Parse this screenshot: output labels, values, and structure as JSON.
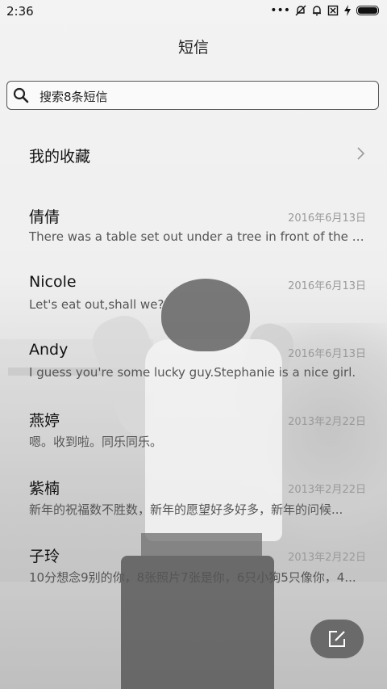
{
  "status_bar": {
    "time": "2:36",
    "icons": [
      "more-dots-icon",
      "bell-off-icon",
      "alarm-icon",
      "sim-disabled-icon",
      "charging-icon",
      "battery-icon"
    ]
  },
  "header": {
    "title": "短信"
  },
  "search": {
    "placeholder": "搜索8条短信",
    "icon": "search-icon"
  },
  "favorites": {
    "label": "我的收藏",
    "icon": "chevron-right-icon"
  },
  "messages": [
    {
      "name": "倩倩",
      "date": "2016年6月13日",
      "preview": "There was a table set out under a tree in front of the ho..."
    },
    {
      "name": "Nicole",
      "date": "2016年6月13日",
      "preview": "Let's eat out,shall we?"
    },
    {
      "name": "Andy",
      "date": "2016年6月13日",
      "preview": "I guess you're some lucky guy.Stephanie is a nice girl."
    },
    {
      "name": "燕婷",
      "date": "2013年2月22日",
      "preview": "嗯。收到啦。同乐同乐。"
    },
    {
      "name": "紫楠",
      "date": "2013年2月22日",
      "preview": "新年的祝福数不胜数，新年的愿望好多好多，新年的问候..."
    },
    {
      "name": "子玲",
      "date": "2013年2月22日",
      "preview": "10分想念9别的你，8张照片7张是你，6只小狗5只像你，4..."
    }
  ],
  "compose": {
    "icon": "compose-icon"
  }
}
